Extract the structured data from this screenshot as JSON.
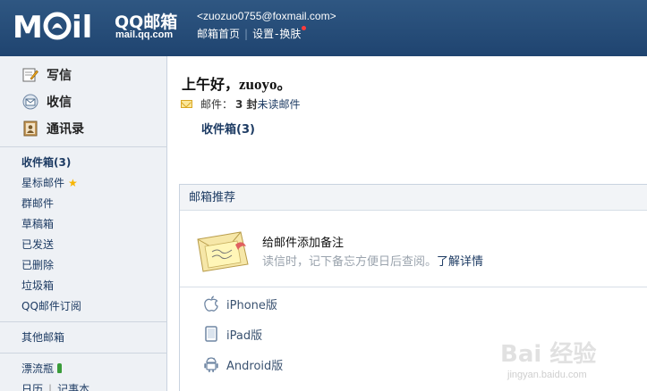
{
  "header": {
    "logo_alt": "MOIL",
    "logo_qq": "QQ邮箱",
    "logo_url": "mail.qq.com",
    "user_email": "<zuozuo0755@foxmail.com>",
    "links": {
      "home": "邮箱首页",
      "settings": "设置",
      "skin": "换肤"
    }
  },
  "sidebar": {
    "main_items": [
      {
        "label": "写信",
        "icon": "compose-icon"
      },
      {
        "label": "收信",
        "icon": "receive-icon"
      },
      {
        "label": "通讯录",
        "icon": "contacts-icon"
      }
    ],
    "folders": {
      "inbox": "收件箱(3)",
      "starred": "星标邮件",
      "group": "群邮件",
      "drafts": "草稿箱",
      "sent": "已发送",
      "deleted": "已删除",
      "trash": "垃圾箱",
      "subscriptions": "QQ邮件订阅"
    },
    "other_mailbox": "其他邮箱",
    "drift_bottle": "漂流瓶",
    "calendar": "日历",
    "notes": "记事本"
  },
  "main": {
    "greeting_prefix": "上午好，",
    "greeting_name": "zuoyo",
    "greeting_suffix": "。",
    "mail_label": "邮件：",
    "mail_count": "3 封",
    "unread_label": "未读邮件",
    "inbox_link": "收件箱(3)",
    "panel_title": "邮箱推荐",
    "rec_title": "给邮件添加备注",
    "rec_desc": "读信时，记下备忘方便日后查阅。",
    "rec_more": "了解详情",
    "apps": [
      {
        "label": "iPhone版",
        "icon": "apple-icon"
      },
      {
        "label": "iPad版",
        "icon": "ipad-icon"
      },
      {
        "label": "Android版",
        "icon": "android-icon"
      }
    ]
  },
  "watermark": {
    "text": "Bai 经验",
    "url": "jingyan.baidu.com"
  }
}
